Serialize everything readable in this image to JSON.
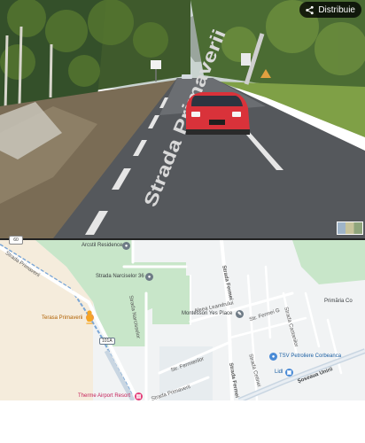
{
  "street_view": {
    "share_label": "Distribuie",
    "road_marking": "Strada Primaverii"
  },
  "map": {
    "scale_badge": "60",
    "places": [
      {
        "id": "arcstil",
        "label": "Arcstil Residences",
        "icon": "pin-icon"
      },
      {
        "id": "narciselor36",
        "label": "Strada Narciselor 36",
        "icon": "pin-icon"
      },
      {
        "id": "terasa",
        "label": "Terasa Primaverii",
        "icon": "restaurant-icon"
      },
      {
        "id": "montessori",
        "label": "Montessori Yes Place",
        "icon": "school-icon"
      },
      {
        "id": "tsv",
        "label": "TSV Petroliere Corbeanca",
        "icon": "pin-icon"
      },
      {
        "id": "lidl",
        "label": "Lidl",
        "icon": "shopping-icon"
      },
      {
        "id": "therme",
        "label": "Therme Airport Resort",
        "icon": "hotel-icon"
      },
      {
        "id": "primaria",
        "label": "Primăria Co",
        "icon": "none"
      }
    ],
    "streets": [
      {
        "id": "primaverii-nw",
        "label": "Strada Primaverii"
      },
      {
        "id": "narcisselor",
        "label": "Strada Narcisselor"
      },
      {
        "id": "fermei-n",
        "label": "Strada Fermei"
      },
      {
        "id": "leandrului",
        "label": "Aleea Leandrului"
      },
      {
        "id": "fermei-g",
        "label": "Str. Fermei G"
      },
      {
        "id": "castanilor",
        "label": "Strada Castanilor"
      },
      {
        "id": "fermierilor",
        "label": "Str. Fermierilor"
      },
      {
        "id": "fermei-s",
        "label": "Strada Fermei"
      },
      {
        "id": "cetinei",
        "label": "Strada Cetinei"
      },
      {
        "id": "unirii",
        "label": "Șoseaua Unirii"
      },
      {
        "id": "primaverii-s",
        "label": "Strada Primaverii"
      }
    ],
    "route_badge": "101A",
    "colors": {
      "land": "#f1f3f4",
      "park": "#c8e6c9",
      "sand": "#f5ecdc",
      "road": "#ffffff",
      "main_road": "#c9d6e2",
      "route_path": "#7aa6d6",
      "pegman": "#f5a623"
    }
  }
}
